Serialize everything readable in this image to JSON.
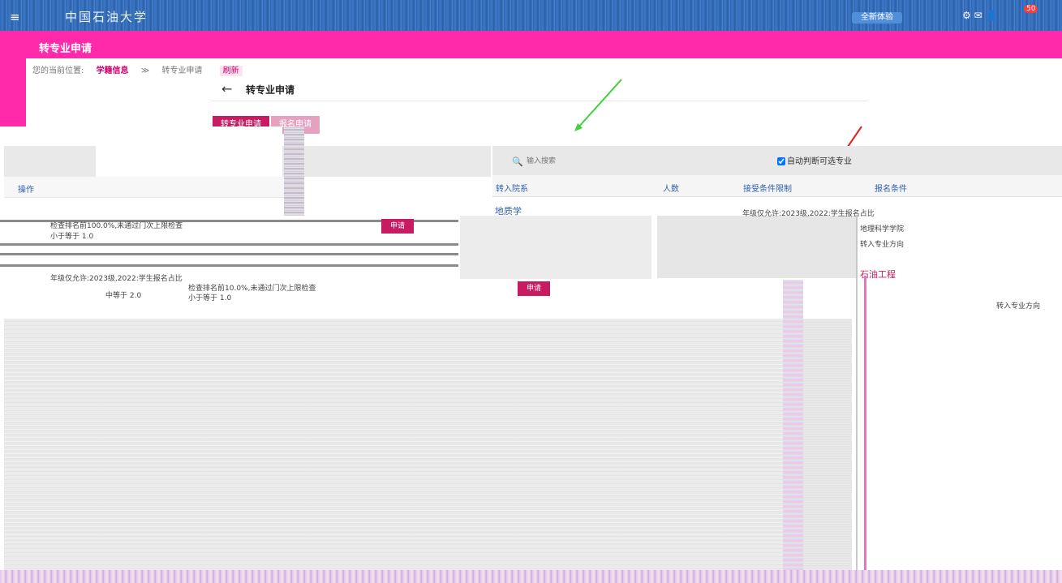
{
  "header": {
    "menu_icon": "≡",
    "logo_text": "中国石油大学",
    "chip_text": "全新体验",
    "right_icons": "⚙ ✉ 👤",
    "badge_count": "50",
    "colors": {
      "topbar": "#2e66b5",
      "titlebar": "#ff2aa9",
      "accent": "#c81c62",
      "link": "#3160b0"
    }
  },
  "page": {
    "title": "转专业申请",
    "breadcrumb_prefix": "您的当前位置:",
    "breadcrumb_section": "学籍信息",
    "breadcrumb_sep": "≫",
    "breadcrumb_current": "转专业申请",
    "refresh_label": "刷新",
    "back_icon": "←",
    "heading": "转专业申请"
  },
  "tabs": [
    {
      "label": "转专业申请"
    },
    {
      "label": "报名申请"
    }
  ],
  "left_table": {
    "op_header": "操作",
    "rows": [
      {
        "text_a": "检查排名前100.0%,未通过门次上限检查",
        "text_b": "小于等于 1.0",
        "apply": "申请"
      },
      {
        "text_a": "年级仅允许:2023级,2022:学生报名占比",
        "text_b": "中等于 2.0",
        "text_c": "检查排名前10.0%,未通过门次上限检查",
        "text_d": "小于等于 1.0",
        "apply": "申请"
      }
    ]
  },
  "search": {
    "icon": "search-icon",
    "placeholder": "输入搜索",
    "auto_check_label": "自动判断可选专业"
  },
  "right_table": {
    "headers": [
      "转入院系",
      "人数",
      "接受条件限制",
      "报名条件"
    ],
    "rows": [
      {
        "dept": "地质学",
        "limit_text": "年级仅允许:2023级,2022:学生报名占比"
      },
      {
        "dept_b": "地理科学学院",
        "note": "转入专业方向"
      },
      {
        "dept_c": "石油工程",
        "note_b": "转入专业方向"
      }
    ]
  }
}
